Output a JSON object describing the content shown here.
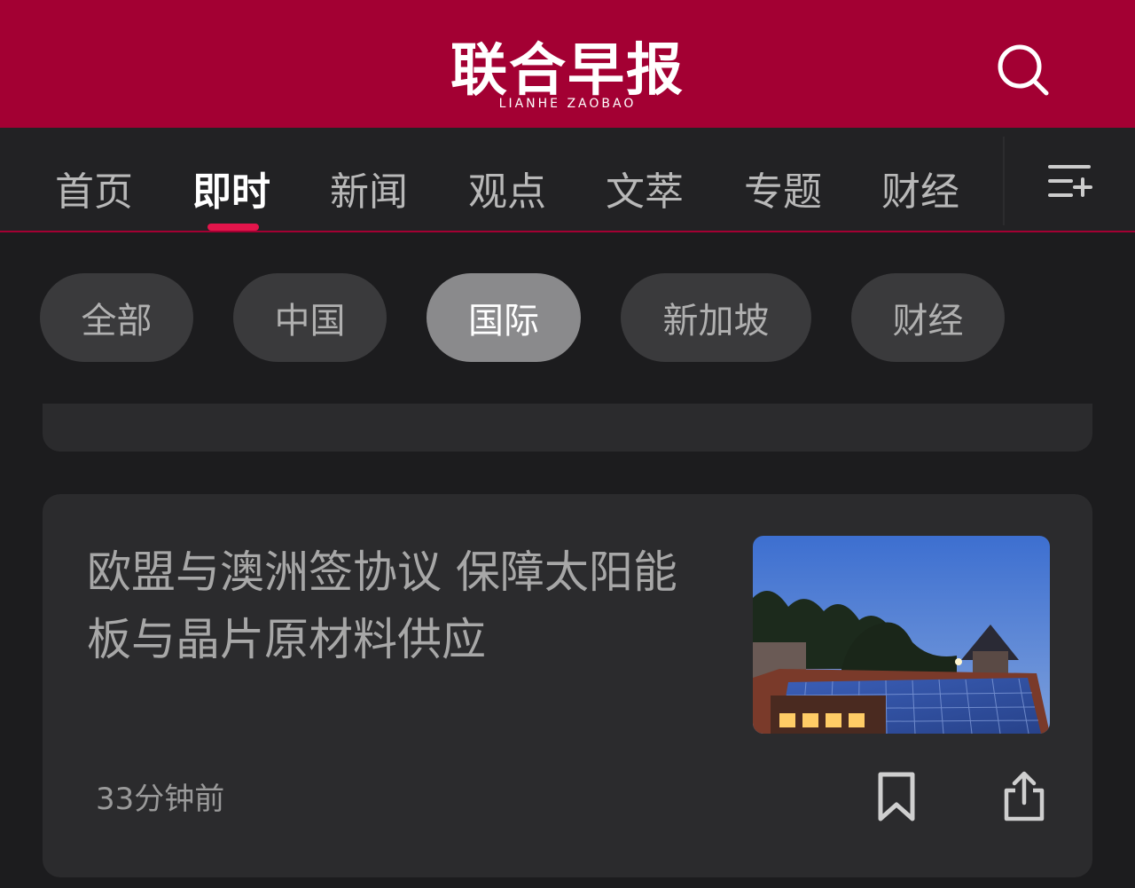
{
  "header": {
    "logo_cn": "联合早报",
    "logo_en": "LIANHE ZAOBAO",
    "search_icon": "search-icon",
    "brand_color": "#a30033"
  },
  "nav": {
    "tabs": [
      {
        "label": "首页",
        "active": false
      },
      {
        "label": "即时",
        "active": true
      },
      {
        "label": "新闻",
        "active": false
      },
      {
        "label": "观点",
        "active": false
      },
      {
        "label": "文萃",
        "active": false
      },
      {
        "label": "专题",
        "active": false
      },
      {
        "label": "财经",
        "active": false
      }
    ],
    "menu_icon": "list-add-icon",
    "accent_color": "#e3154b"
  },
  "filters": {
    "chips": [
      {
        "label": "全部",
        "active": false
      },
      {
        "label": "中国",
        "active": false
      },
      {
        "label": "国际",
        "active": true
      },
      {
        "label": "新加坡",
        "active": false
      },
      {
        "label": "财经",
        "active": false
      }
    ]
  },
  "article": {
    "title": "欧盟与澳洲签协议 保障太阳能板与晶片原材料供应",
    "time": "33分钟前",
    "thumbnail_icon": "solar-panel-house-photo",
    "bookmark_icon": "bookmark-icon",
    "share_icon": "share-icon"
  }
}
